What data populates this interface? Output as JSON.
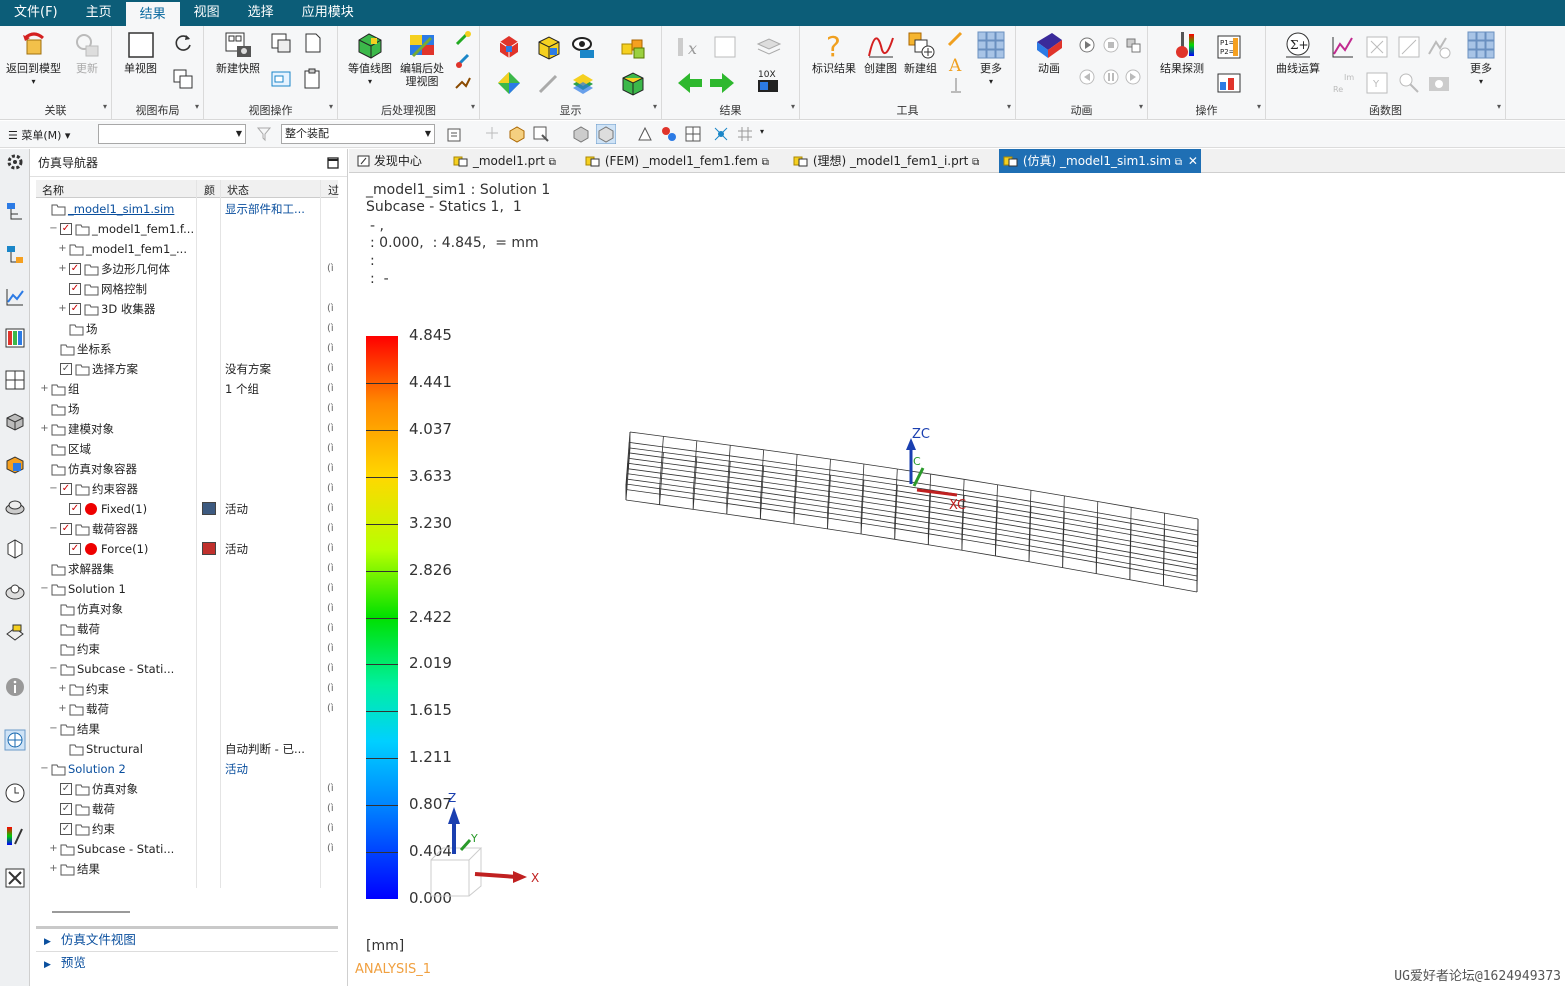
{
  "menubar": {
    "tabs": [
      "文件(F)",
      "主页",
      "结果",
      "视图",
      "选择",
      "应用模块"
    ],
    "active": 2
  },
  "ribbon": {
    "groups": {
      "assoc": "关联",
      "layout": "视图布局",
      "viewops": "视图操作",
      "post": "后处理视图",
      "display": "显示",
      "results": "结果",
      "tools": "工具",
      "anim": "动画",
      "ops": "操作",
      "funcs": "函数图"
    },
    "buttons": {
      "return_model": "返回到模型",
      "update": "更新",
      "single_view": "单视图",
      "new_snapshot": "新建快照",
      "contour": "等值线图",
      "edit_post_1": "编辑后处",
      "edit_post_2": "理视图",
      "identify": "标识结果",
      "create_plot": "创建图",
      "new_group": "新建组",
      "more": "更多",
      "animate": "动画",
      "probe": "结果探测",
      "curve_ops": "曲线运算",
      "more2": "更多"
    }
  },
  "qat": {
    "menu": "菜单(M)",
    "filter_empty": "",
    "assembly_filter": "整个装配"
  },
  "nav": {
    "title": "仿真导航器",
    "headers": {
      "name": "名称",
      "color": "颜",
      "status": "状态",
      "over": "过"
    },
    "rows": [
      {
        "label": "_model1_sim1.sim",
        "indent": 0,
        "exp": "",
        "cb": "",
        "status": "显示部件和工...",
        "link": true
      },
      {
        "label": "_model1_fem1.f...",
        "indent": 1,
        "exp": "−",
        "cb": "x",
        "status": ""
      },
      {
        "label": "_model1_fem1_...",
        "indent": 2,
        "exp": "+",
        "cb": "",
        "status": ""
      },
      {
        "label": "多边形几何体",
        "indent": 2,
        "exp": "+",
        "cb": "x",
        "status": "",
        "ov": "(ì"
      },
      {
        "label": "网格控制",
        "indent": 2,
        "exp": "",
        "cb": "x",
        "status": ""
      },
      {
        "label": "3D 收集器",
        "indent": 2,
        "exp": "+",
        "cb": "x",
        "status": "",
        "ov": "(ì"
      },
      {
        "label": "场",
        "indent": 2,
        "exp": "",
        "cb": "",
        "status": "",
        "ov": "(ì"
      },
      {
        "label": "坐标系",
        "indent": 1,
        "exp": "",
        "cb": "",
        "status": "",
        "ov": "(ì"
      },
      {
        "label": "选择方案",
        "indent": 1,
        "exp": "",
        "cb": "v",
        "status": "没有方案",
        "ov": "(ì"
      },
      {
        "label": "组",
        "indent": 0,
        "exp": "+",
        "cb": "",
        "status": "1 个组",
        "ov": "(ì"
      },
      {
        "label": "场",
        "indent": 0,
        "exp": "",
        "cb": "",
        "status": "",
        "ov": "(ì"
      },
      {
        "label": "建模对象",
        "indent": 0,
        "exp": "+",
        "cb": "",
        "status": "",
        "ov": "(ì"
      },
      {
        "label": "区域",
        "indent": 0,
        "exp": "",
        "cb": "",
        "status": "",
        "ov": "(ì"
      },
      {
        "label": "仿真对象容器",
        "indent": 0,
        "exp": "",
        "cb": "",
        "status": "",
        "ov": "(ì"
      },
      {
        "label": "约束容器",
        "indent": 1,
        "exp": "−",
        "cb": "x",
        "status": "",
        "ov": "(ì"
      },
      {
        "label": "Fixed(1)",
        "indent": 2,
        "exp": "",
        "cb": "x",
        "status": "活动",
        "chip": "#3d5a80",
        "ov": "(ì"
      },
      {
        "label": "载荷容器",
        "indent": 1,
        "exp": "−",
        "cb": "x",
        "status": "",
        "ov": "(ì"
      },
      {
        "label": "Force(1)",
        "indent": 2,
        "exp": "",
        "cb": "x",
        "status": "活动",
        "chip": "#c0302c",
        "ov": "(ì"
      },
      {
        "label": "求解器集",
        "indent": 0,
        "exp": "",
        "cb": "",
        "status": "",
        "ov": "(ì"
      },
      {
        "label": "Solution 1",
        "indent": 0,
        "exp": "−",
        "cb": "",
        "status": "",
        "ov": "(ì"
      },
      {
        "label": "仿真对象",
        "indent": 1,
        "exp": "",
        "cb": "",
        "status": "",
        "ov": "(ì"
      },
      {
        "label": "载荷",
        "indent": 1,
        "exp": "",
        "cb": "",
        "status": "",
        "ov": "(ì"
      },
      {
        "label": "约束",
        "indent": 1,
        "exp": "",
        "cb": "",
        "status": "",
        "ov": "(ì"
      },
      {
        "label": "Subcase - Stati...",
        "indent": 1,
        "exp": "−",
        "cb": "",
        "status": "",
        "ov": "(ì"
      },
      {
        "label": "约束",
        "indent": 2,
        "exp": "+",
        "cb": "",
        "status": "",
        "ov": "(ì"
      },
      {
        "label": "载荷",
        "indent": 2,
        "exp": "+",
        "cb": "",
        "status": "",
        "ov": "(ì"
      },
      {
        "label": "结果",
        "indent": 1,
        "exp": "−",
        "cb": "",
        "status": ""
      },
      {
        "label": "Structural",
        "indent": 2,
        "exp": "",
        "cb": "",
        "status": "自动判断 - 已..."
      },
      {
        "label": "Solution 2",
        "indent": 0,
        "exp": "−",
        "cb": "",
        "status": "活动",
        "link": true
      },
      {
        "label": "仿真对象",
        "indent": 1,
        "exp": "",
        "cb": "v",
        "status": "",
        "ov": "(ì"
      },
      {
        "label": "载荷",
        "indent": 1,
        "exp": "",
        "cb": "v",
        "status": "",
        "ov": "(ì"
      },
      {
        "label": "约束",
        "indent": 1,
        "exp": "",
        "cb": "v",
        "status": "",
        "ov": "(ì"
      },
      {
        "label": "Subcase - Stati...",
        "indent": 1,
        "exp": "+",
        "cb": "",
        "status": "",
        "ov": "(ì"
      },
      {
        "label": "结果",
        "indent": 1,
        "exp": "+",
        "cb": "",
        "status": ""
      }
    ],
    "footer": [
      "仿真文件视图",
      "预览"
    ]
  },
  "doctabs": [
    "发现中心",
    "_model1.prt",
    "(FEM) _model1_fem1.fem",
    "(理想) _model1_fem1_i.prt",
    "(仿真) _model1_sim1.sim"
  ],
  "viewport": {
    "line1": "_model1_sim1 : Solution 1",
    "line2": "Subcase - Statics 1,  1",
    "line3": "- ,",
    "line4": ": 0.000,  : 4.845,  = mm",
    "line5": ":",
    "line6": ":  -",
    "legend": [
      "4.845",
      "4.441",
      "4.037",
      "3.633",
      "3.230",
      "2.826",
      "2.422",
      "2.019",
      "1.615",
      "1.211",
      "0.807",
      "0.404",
      "0.000"
    ],
    "unit": "[mm]",
    "analysis": "ANALYSIS_1",
    "wcs_z": "ZC",
    "wcs_x": "XC",
    "wcs_c": "C",
    "axis_x": "X",
    "axis_y": "Y",
    "axis_z": "Z"
  },
  "watermark": "UG爱好者论坛@1624949373"
}
